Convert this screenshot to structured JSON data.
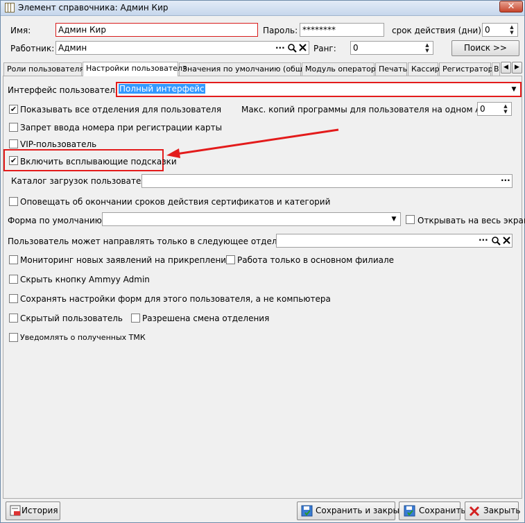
{
  "window": {
    "title": "Элемент справочника: Админ Кир",
    "close_symbol": "✕"
  },
  "header": {
    "name_label": "Имя:",
    "name_value": "Админ Кир",
    "password_label": "Пароль:",
    "password_value": "********",
    "term_label": "срок действия (дни):",
    "term_value": "0",
    "worker_label": "Работник:",
    "worker_value": "Админ",
    "rank_label": "Ранг:",
    "rank_value": "0",
    "search_button": "Поиск  >>"
  },
  "tabs": [
    {
      "label": "Роли пользователя",
      "active": false
    },
    {
      "label": "Настройки пользователя",
      "active": true
    },
    {
      "label": "Значения по умолчанию (общие)",
      "active": false
    },
    {
      "label": "Модуль оператора",
      "active": false
    },
    {
      "label": "Печать",
      "active": false
    },
    {
      "label": "Кассир",
      "active": false
    },
    {
      "label": "Регистратор",
      "active": false
    },
    {
      "label": "В",
      "active": false
    }
  ],
  "settings": {
    "interface_label": "Интерфейс пользователя:",
    "interface_value": "Полный интерфейс",
    "show_all_departments": {
      "label": "Показывать все отделения для пользователя",
      "checked": true
    },
    "max_copies_label": "Макс. копий программы для пользователя на одном АРМ:",
    "max_copies_value": "0",
    "ban_card_number": {
      "label": "Запрет ввода номера при регистрации карты",
      "checked": false
    },
    "vip_user": {
      "label": "VIP-пользователь",
      "checked": false
    },
    "enable_tooltips": {
      "label": "Включить всплывающие подсказки",
      "checked": true
    },
    "downloads_catalog_label": "Каталог загрузок пользователя:",
    "downloads_catalog_value": "",
    "notify_expiry": {
      "label": "Оповещать об окончании сроков действия сертификатов и категорий",
      "checked": false
    },
    "default_form_label": "Форма по умолчанию:",
    "default_form_value": "",
    "open_fullscreen": {
      "label": "Открывать на весь экран",
      "checked": false
    },
    "redirect_label": "Пользователь может направлять только в следующее отделение:",
    "redirect_value": "",
    "monitoring": {
      "label": "Мониторинг новых заявлений на прикрепление",
      "checked": false
    },
    "main_branch_only": {
      "label": "Работа только в основном филиале",
      "checked": false
    },
    "hide_ammyy": {
      "label": "Скрыть кнопку Ammyy Admin",
      "checked": false
    },
    "save_form_settings": {
      "label": "Сохранять настройки форм для этого пользователя, а не компьютера",
      "checked": false
    },
    "hidden_user": {
      "label": "Скрытый пользователь",
      "checked": false
    },
    "allow_dept_change": {
      "label": "Разрешена смена отделения",
      "checked": false
    },
    "notify_tmk": {
      "label": "Уведомлять о полученных ТМК",
      "checked": false
    }
  },
  "footer": {
    "history_button": "История",
    "save_close_button": "Сохранить и закрыть",
    "save_button": "Сохранить",
    "close_button": "Закрыть"
  },
  "colors": {
    "annotation_red": "#e31b1b",
    "selection_blue": "#3399ff"
  }
}
